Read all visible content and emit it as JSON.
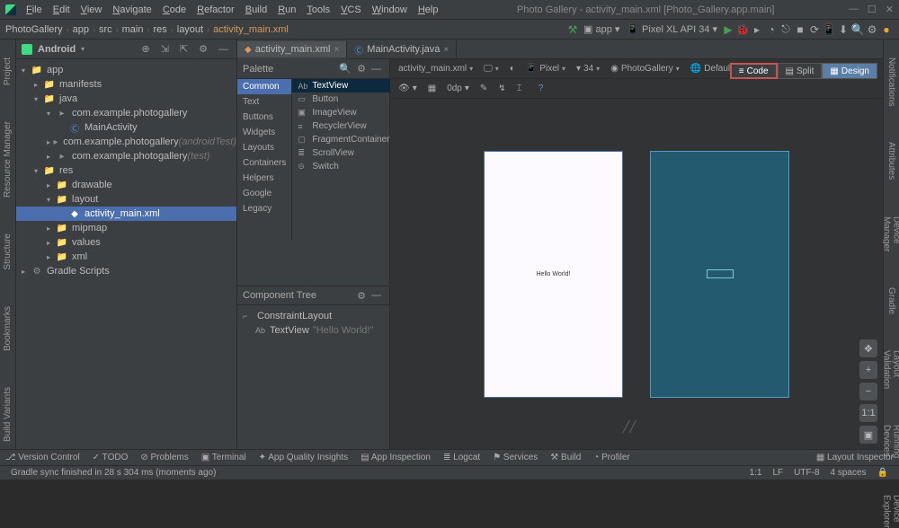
{
  "titlebar": {
    "menu": [
      "File",
      "Edit",
      "View",
      "Navigate",
      "Code",
      "Refactor",
      "Build",
      "Run",
      "Tools",
      "VCS",
      "Window",
      "Help"
    ],
    "title": "Photo Gallery - activity_main.xml [Photo_Gallery.app.main]"
  },
  "navbar": {
    "crumbs": [
      "PhotoGallery",
      "app",
      "src",
      "main",
      "res",
      "layout",
      "activity_main.xml"
    ],
    "run_config": "app",
    "device": "Pixel XL API 34"
  },
  "project_panel": {
    "header": "Android",
    "tree": [
      {
        "indent": 0,
        "arrow": "▾",
        "ico": "folder",
        "txt": "app"
      },
      {
        "indent": 1,
        "arrow": "▸",
        "ico": "folder",
        "txt": "manifests"
      },
      {
        "indent": 1,
        "arrow": "▾",
        "ico": "folder",
        "txt": "java"
      },
      {
        "indent": 2,
        "arrow": "▾",
        "ico": "pkg",
        "txt": "com.example.photogallery"
      },
      {
        "indent": 3,
        "arrow": "",
        "ico": "class",
        "txt": "MainActivity"
      },
      {
        "indent": 2,
        "arrow": "▸",
        "ico": "pkg",
        "txt": "com.example.photogallery",
        "dim": "(androidTest)"
      },
      {
        "indent": 2,
        "arrow": "▸",
        "ico": "pkg",
        "txt": "com.example.photogallery",
        "dim": "(test)"
      },
      {
        "indent": 1,
        "arrow": "▾",
        "ico": "folder",
        "txt": "res"
      },
      {
        "indent": 2,
        "arrow": "▸",
        "ico": "folder",
        "txt": "drawable"
      },
      {
        "indent": 2,
        "arrow": "▾",
        "ico": "folder",
        "txt": "layout"
      },
      {
        "indent": 3,
        "arrow": "",
        "ico": "file",
        "txt": "activity_main.xml",
        "selected": true
      },
      {
        "indent": 2,
        "arrow": "▸",
        "ico": "folder",
        "txt": "mipmap"
      },
      {
        "indent": 2,
        "arrow": "▸",
        "ico": "folder",
        "txt": "values"
      },
      {
        "indent": 2,
        "arrow": "▸",
        "ico": "folder",
        "txt": "xml"
      },
      {
        "indent": 0,
        "arrow": "▸",
        "ico": "gradle",
        "txt": "Gradle Scripts"
      }
    ]
  },
  "tabs": [
    {
      "label": "activity_main.xml",
      "ico": "xml",
      "active": true
    },
    {
      "label": "MainActivity.java",
      "ico": "java",
      "active": false
    }
  ],
  "palette": {
    "header": "Palette",
    "categories": [
      "Common",
      "Text",
      "Buttons",
      "Widgets",
      "Layouts",
      "Containers",
      "Helpers",
      "Google",
      "Legacy"
    ],
    "selected_cat": "Common",
    "items": [
      {
        "label": "TextView",
        "prefix": "Ab",
        "sel": true
      },
      {
        "label": "Button",
        "prefix": "▭"
      },
      {
        "label": "ImageView",
        "prefix": "▣"
      },
      {
        "label": "RecyclerView",
        "prefix": "≡"
      },
      {
        "label": "FragmentContainerVi...",
        "prefix": "▢"
      },
      {
        "label": "ScrollView",
        "prefix": "≣"
      },
      {
        "label": "Switch",
        "prefix": "⊝"
      }
    ]
  },
  "component_tree": {
    "header": "Component Tree",
    "rows": [
      {
        "indent": 0,
        "ico": "⌐",
        "txt": "ConstraintLayout"
      },
      {
        "indent": 1,
        "ico": "Ab",
        "txt": "TextView",
        "dim": "\"Hello World!\""
      }
    ]
  },
  "canvas_toolbar": {
    "file": "activity_main.xml",
    "orientation": "",
    "device": "Pixel",
    "api": "34",
    "theme": "PhotoGallery",
    "locale": "Default (en-us)"
  },
  "canvas_toolbar2": {
    "zoom": "0dp"
  },
  "view_switch": {
    "code": "Code",
    "split": "Split",
    "design": "Design"
  },
  "preview_text": "Hello World!",
  "left_strip": [
    "Project",
    "Resource Manager",
    "Structure",
    "Bookmarks",
    "Build Variants"
  ],
  "right_strip": [
    "Notifications",
    "Attributes",
    "Device Manager",
    "Gradle",
    "Layout Validation",
    "Running Devices",
    "Device Explorer"
  ],
  "bottombar": [
    "Version Control",
    "TODO",
    "Problems",
    "Terminal",
    "App Quality Insights",
    "App Inspection",
    "Logcat",
    "Services",
    "Build",
    "Profiler"
  ],
  "bottombar_right": "Layout Inspector",
  "statusbar": {
    "msg": "Gradle sync finished in 28 s 304 ms (moments ago)",
    "pos": "1:1",
    "le": "LF",
    "enc": "UTF-8",
    "indent": "4 spaces"
  }
}
